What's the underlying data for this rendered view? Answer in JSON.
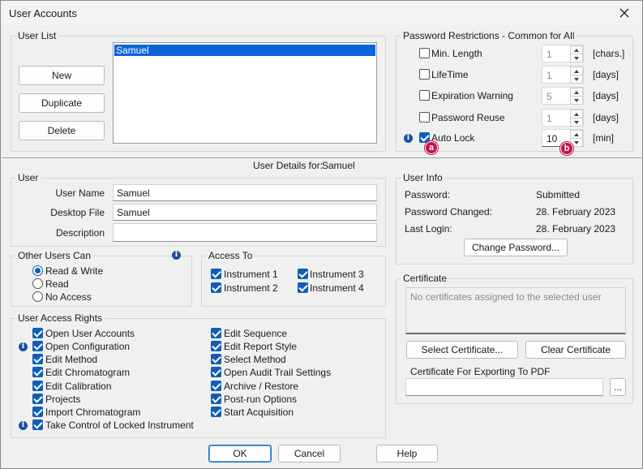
{
  "window": {
    "title": "User Accounts"
  },
  "user_list": {
    "label": "User List",
    "buttons": {
      "new": "New",
      "duplicate": "Duplicate",
      "delete": "Delete"
    },
    "users": [
      "Samuel"
    ],
    "selected": "Samuel"
  },
  "password_restrictions": {
    "label": "Password Restrictions - Common for All",
    "rows": [
      {
        "label": "Min. Length",
        "checked": false,
        "value": "1",
        "unit": "[chars.]"
      },
      {
        "label": "LifeTime",
        "checked": false,
        "value": "1",
        "unit": "[days]"
      },
      {
        "label": "Expiration Warning",
        "checked": false,
        "value": "5",
        "unit": "[days]"
      },
      {
        "label": "Password Reuse",
        "checked": false,
        "value": "1",
        "unit": "[days]"
      },
      {
        "label": "Auto Lock",
        "checked": true,
        "value": "10",
        "unit": "[min]"
      }
    ],
    "markers": {
      "a": "a",
      "b": "b"
    }
  },
  "user_details": {
    "prefix": "User Details for:",
    "name": "Samuel"
  },
  "user": {
    "label": "User",
    "user_name_label": "User Name",
    "user_name": "Samuel",
    "desktop_file_label": "Desktop File",
    "desktop_file": "Samuel",
    "description_label": "Description",
    "description": ""
  },
  "other_users": {
    "label": "Other Users Can",
    "options": [
      "Read & Write",
      "Read",
      "No Access"
    ],
    "selected": "Read & Write"
  },
  "access_to": {
    "label": "Access To",
    "items": [
      "Instrument 1",
      "Instrument 3",
      "Instrument 2",
      "Instrument 4"
    ]
  },
  "access_rights": {
    "label": "User Access Rights",
    "left": [
      "Open User Accounts",
      "Open Configuration",
      "Edit Method",
      "Edit Chromatogram",
      "Edit Calibration",
      "Projects",
      "Import Chromatogram",
      "Take Control of Locked Instrument"
    ],
    "right": [
      "Edit Sequence",
      "Edit Report Style",
      "Select Method",
      "Open Audit Trail Settings",
      "Archive / Restore",
      "Post-run Options",
      "Start Acquisition"
    ]
  },
  "user_info": {
    "label": "User Info",
    "password_label": "Password:",
    "password": "Submitted",
    "changed_label": "Password Changed:",
    "changed": "28. February 2023",
    "login_label": "Last Login:",
    "login": "28. February 2023",
    "change_button": "Change Password..."
  },
  "certificate": {
    "label": "Certificate",
    "empty_text": "No certificates assigned to the selected user",
    "select_button": "Select Certificate...",
    "clear_button": "Clear Certificate",
    "export_label": "Certificate For Exporting To PDF",
    "export_value": "",
    "browse_button": "..."
  },
  "footer": {
    "ok": "OK",
    "cancel": "Cancel",
    "help": "Help"
  },
  "icons": {
    "info": "info-icon",
    "close": "close-icon"
  },
  "colors": {
    "accent": "#0f5fb5",
    "selection": "#0a64d8",
    "marker": "#c2124f"
  }
}
